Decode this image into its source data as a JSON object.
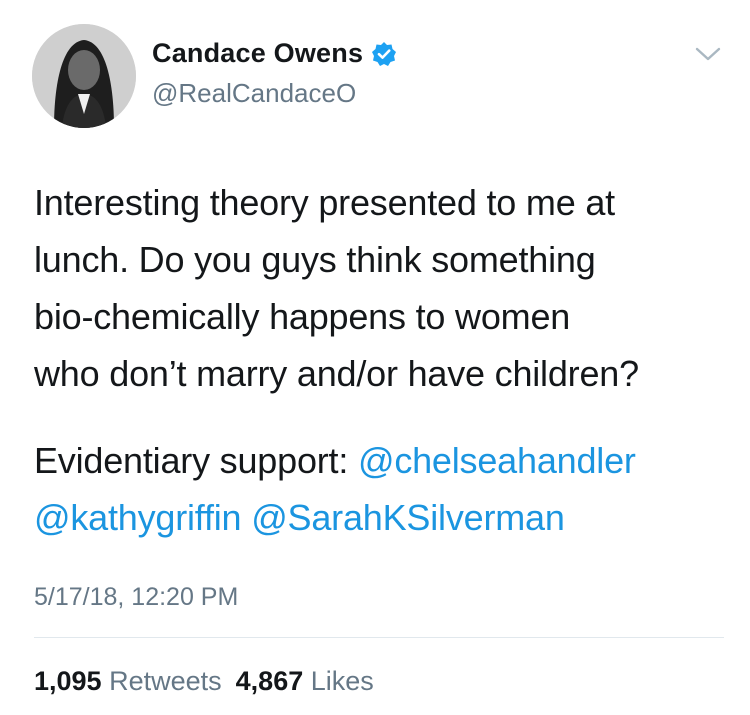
{
  "author": {
    "display_name": "Candace Owens",
    "handle": "@RealCandaceO",
    "verified": true
  },
  "icons": {
    "verified": "verified-badge-icon",
    "menu": "chevron-down-icon"
  },
  "tweet": {
    "line1": "Interesting theory presented to me at",
    "line2": "lunch. Do you guys think something",
    "line3": "bio-chemically happens to women",
    "line4": "who don’t marry and/or have children?",
    "para2_prefix": "Evidentiary support: ",
    "mention1": "@chelseahandler",
    "mention2": "@kathygriffin",
    "mention3": "@SarahKSilverman",
    "timestamp": "5/17/18, 12:20 PM"
  },
  "stats": {
    "retweets_count": "1,095",
    "retweets_label": "Retweets",
    "likes_count": "4,867",
    "likes_label": "Likes"
  },
  "colors": {
    "link": "#1b95e0",
    "verified": "#1da1f2",
    "secondary_text": "#657786"
  }
}
